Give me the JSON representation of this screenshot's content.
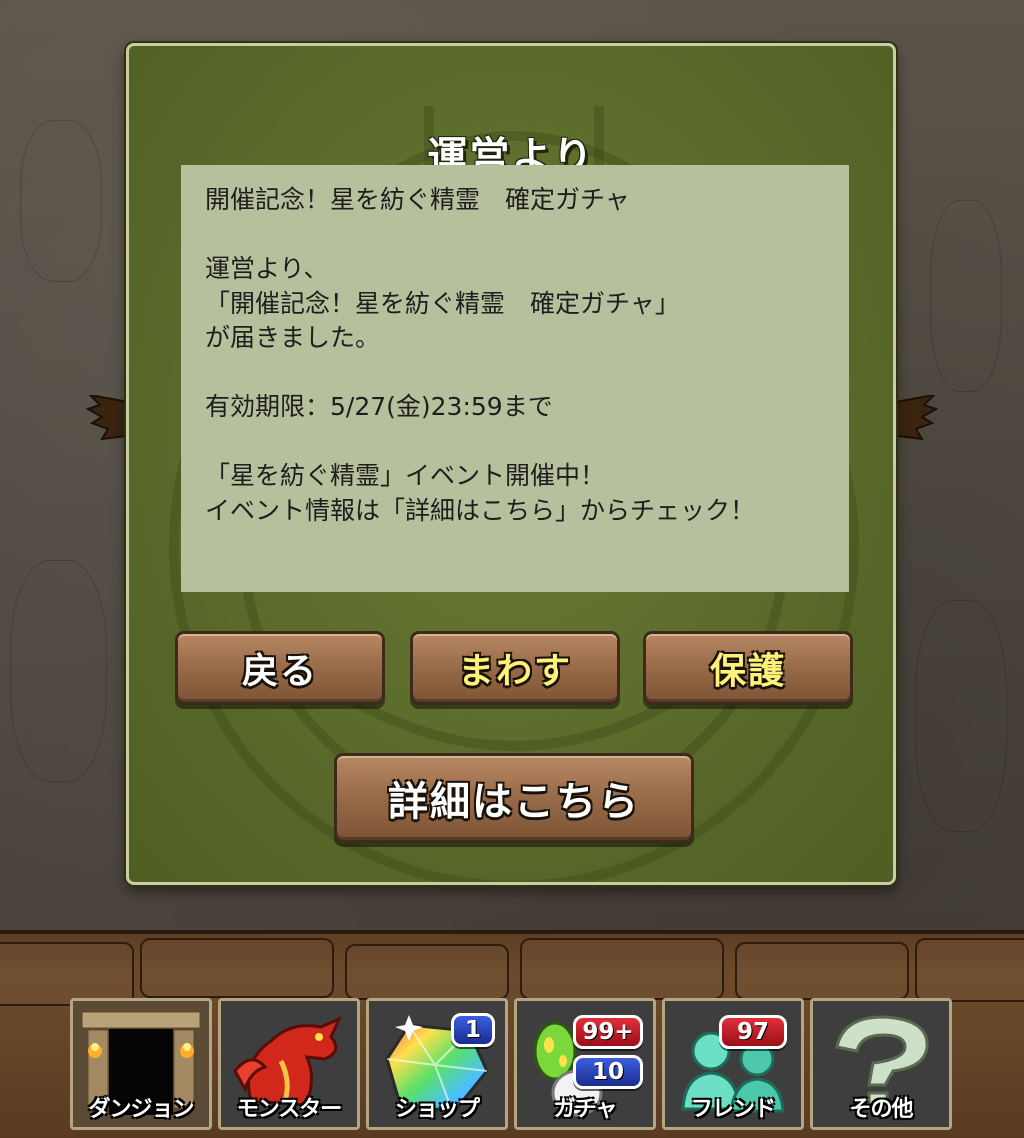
{
  "dialog": {
    "title": "運営より",
    "message": "開催記念！星を紡ぐ精霊　確定ガチャ\n\n運営より、\n「開催記念！星を紡ぐ精霊　確定ガチャ」\nが届きました。\n\n有効期限：5/27(金)23:59まで\n\n「星を紡ぐ精霊」イベント開催中！\nイベント情報は「詳細はこちら」からチェック！"
  },
  "buttons": {
    "back_label": "戻る",
    "spin_label": "まわす",
    "protect_label": "保護",
    "details_label": "詳細はこちら"
  },
  "nav": {
    "dungeon": {
      "label": "ダンジョン",
      "icon": "dungeon-gate-icon"
    },
    "monster": {
      "label": "モンスター",
      "icon": "red-dragon-icon"
    },
    "shop": {
      "label": "ショップ",
      "icon": "rainbow-gem-icon",
      "badge": "1"
    },
    "gacha": {
      "label": "ガチャ",
      "icon": "egg-icon",
      "badge_top": "99+",
      "badge_bottom": "10"
    },
    "friend": {
      "label": "フレンド",
      "icon": "friends-icon",
      "badge": "97"
    },
    "other": {
      "label": "その他",
      "icon": "question-mark-icon"
    }
  },
  "colors": {
    "dialog_green": "#5b6b2b",
    "message_bg": "#b7c09c",
    "button_brown": "#946846",
    "highlight_yellow": "#fff27a",
    "badge_red": "#c0202a",
    "badge_blue": "#2a45c0"
  }
}
